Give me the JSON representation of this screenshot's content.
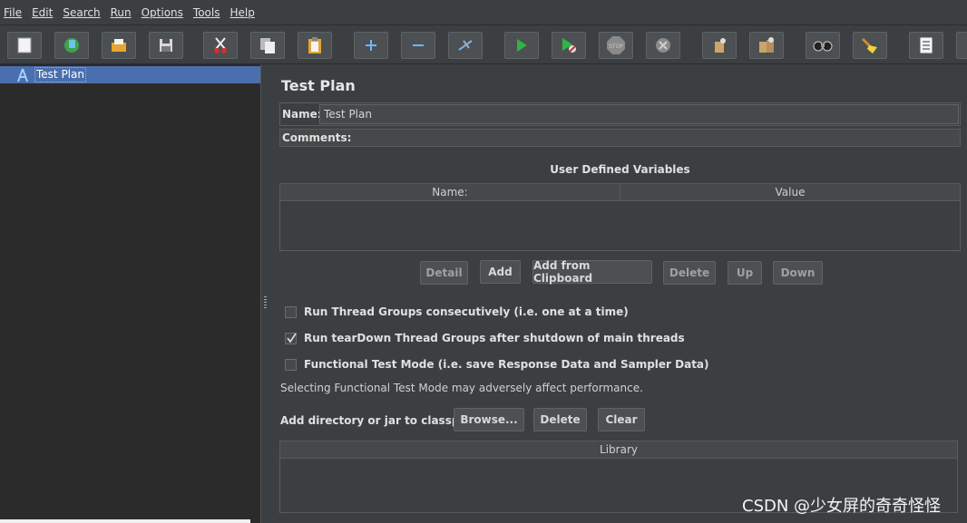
{
  "menu": [
    "File",
    "Edit",
    "Search",
    "Run",
    "Options",
    "Tools",
    "Help"
  ],
  "toolbar": {
    "icons": [
      "new-icon",
      "templates-icon",
      "open-icon",
      "save-icon",
      "cut-icon",
      "copy-icon",
      "paste-icon",
      "expand-icon",
      "collapse-icon",
      "toggle-icon",
      "start-icon",
      "start-no-pauses-icon",
      "stop-icon",
      "shutdown-icon",
      "clear-icon",
      "clear-all-icon",
      "search-icon",
      "reset-search-icon",
      "function-helper-icon"
    ],
    "stop_text": "STOP"
  },
  "tree": {
    "selected_label": "Test Plan"
  },
  "panel": {
    "title": "Test Plan",
    "name_label": "Name:",
    "name_value": "Test Plan",
    "comments_label": "Comments:"
  },
  "udv": {
    "title": "User Defined Variables",
    "columns": [
      "Name:",
      "Value"
    ],
    "buttons": {
      "detail": "Detail",
      "add": "Add",
      "add_clipboard": "Add from Clipboard",
      "delete": "Delete",
      "up": "Up",
      "down": "Down"
    }
  },
  "options": {
    "consecutive": {
      "label": "Run Thread Groups consecutively (i.e. one at a time)",
      "checked": false
    },
    "teardown": {
      "label": "Run tearDown Thread Groups after shutdown of main threads",
      "checked": true
    },
    "functional": {
      "label": "Functional Test Mode (i.e. save Response Data and Sampler Data)",
      "checked": false
    }
  },
  "perf_note": "Selecting Functional Test Mode may adversely affect performance.",
  "classpath": {
    "label": "Add directory or jar to classpath",
    "browse": "Browse...",
    "delete": "Delete",
    "clear": "Clear",
    "library_header": "Library"
  },
  "watermark": "CSDN @少女屏的奇奇怪怪"
}
